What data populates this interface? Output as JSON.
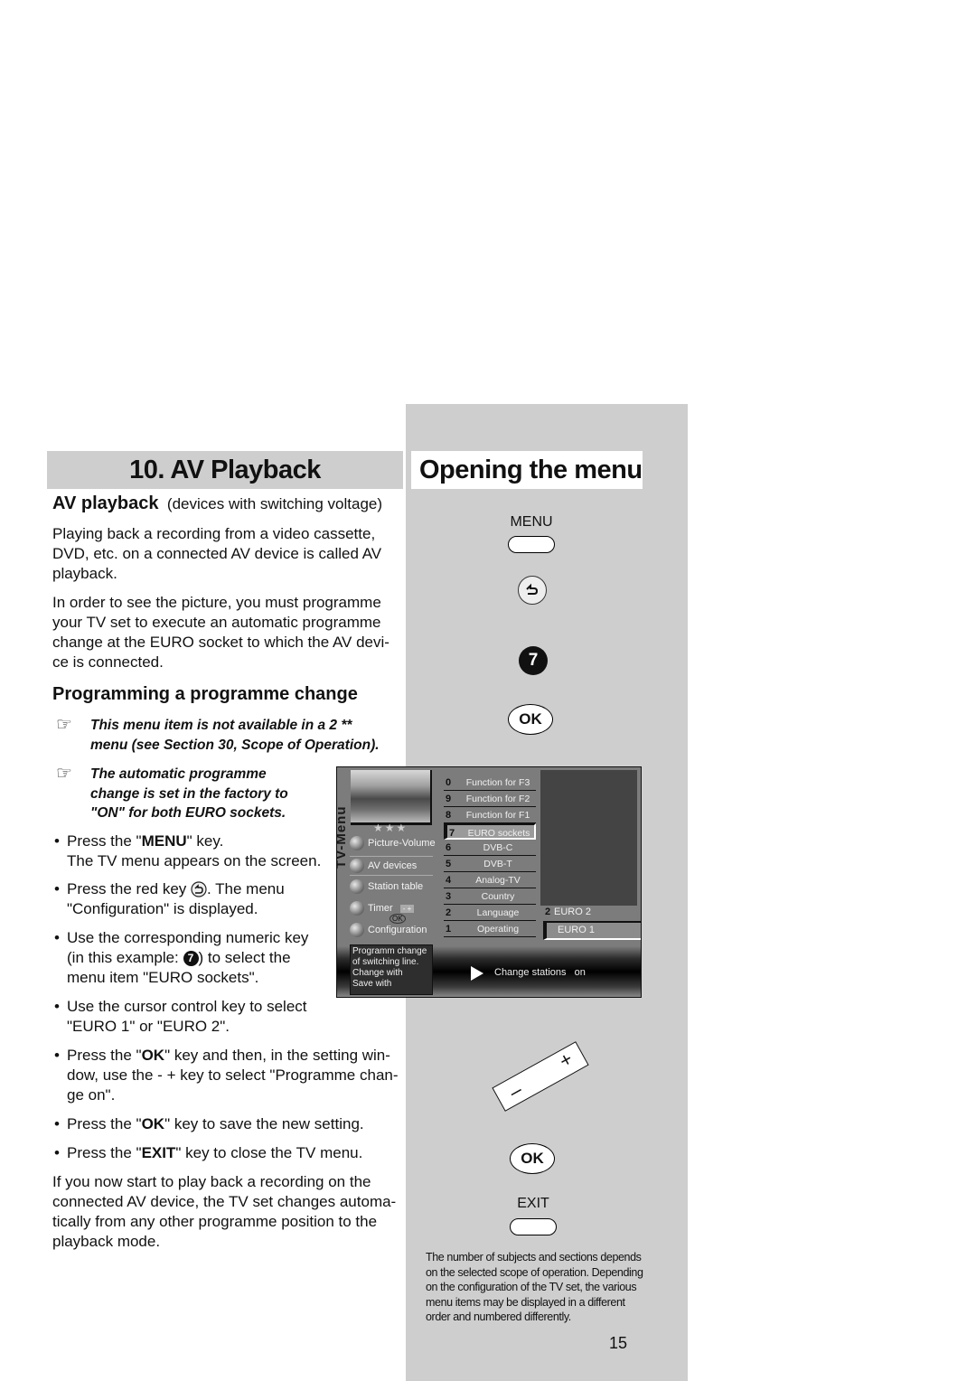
{
  "left": {
    "section_title": "10. AV Playback",
    "subtitle_bold": "AV playback",
    "subtitle_note": "(devices with switching voltage)",
    "intro_p1": [
      "Playing back a recording from a video cassette,",
      "DVD, etc. on a connected AV device is called AV",
      "playback."
    ],
    "intro_p2": [
      "In order to see the picture, you must programme",
      "your TV set to execute an automatic programme",
      "change at the EURO socket to which the AV devi-",
      "ce is connected."
    ],
    "heading": "Programming a programme change",
    "note_icon": "☞",
    "note1": [
      "This menu item is not available in a 2 **",
      "menu (see Section 30, Scope of Operation)."
    ],
    "note2": [
      "The automatic programme",
      "change is set in the factory to",
      "\"ON\" for both EURO sockets."
    ],
    "steps": [
      {
        "pre": "Press the \"",
        "bold": "MENU",
        "post": "\" key.",
        "line2": "The TV menu appears on the screen."
      },
      {
        "pre": "Press the red key ",
        "icon": "red-return-key-icon",
        "post": ". The menu",
        "line2": "\"Configuration\" is displayed."
      },
      {
        "line1": "Use the corresponding numeric key",
        "line2_pre": "(in this example: ",
        "key": "7",
        "line2_post": ") to select the",
        "line3": "menu item \"EURO sockets\"."
      },
      {
        "line1": "Use the cursor control key to select",
        "line2": "\"EURO 1\" or \"EURO 2\"."
      },
      {
        "pre": "Press the \"",
        "bold": "OK",
        "post": "\" key and then, in the setting win-",
        "line2": "dow, use the - + key to select \"Programme chan-",
        "line3": "ge on\"."
      },
      {
        "pre": "Press the \"",
        "bold": "OK",
        "post": "\" key to save the new setting."
      },
      {
        "pre": "Press the \"",
        "bold": "EXIT",
        "post": "\" key to close the TV menu."
      }
    ],
    "closing": [
      "If you now start to play back a recording on the",
      "connected AV device, the TV set changes automa-",
      "tically from any other programme position to the",
      "playback mode."
    ]
  },
  "right": {
    "section_title": "Opening the menu",
    "menu_key_label": "MENU",
    "number_key": "7",
    "ok_label": "OK",
    "exit_key_label": "EXIT",
    "rocker_minus": "–",
    "rocker_plus": "+",
    "footnote": [
      "The number of subjects and sections depends",
      "on the selected scope of operation. Depending",
      "on the configuration of the TV set, the various",
      "menu items may be displayed in a different",
      "order and numbered differently."
    ],
    "page_number": "15"
  },
  "tv": {
    "stars": "★★★",
    "vertical_label": "TV-Menu",
    "menu_items": [
      "Picture-Volume",
      "AV devices",
      "Station table",
      "Timer",
      "Configuration"
    ],
    "timer_hint": "- +",
    "ok_hint": "OK",
    "config_list": [
      {
        "n": "0",
        "label": "Function for F3"
      },
      {
        "n": "9",
        "label": "Function for F2"
      },
      {
        "n": "8",
        "label": "Function for F1"
      },
      {
        "n": "7",
        "label": "EURO sockets",
        "selected": true
      },
      {
        "n": "6",
        "label": "DVB-C"
      },
      {
        "n": "5",
        "label": "DVB-T"
      },
      {
        "n": "4",
        "label": "Analog-TV"
      },
      {
        "n": "3",
        "label": "Country"
      },
      {
        "n": "2",
        "label": "Language"
      },
      {
        "n": "1",
        "label": "Operating"
      }
    ],
    "euro_list": [
      {
        "n": "2",
        "label": "EURO 2"
      },
      {
        "n": "",
        "label": "EURO 1",
        "selected": true
      }
    ],
    "info_lines": [
      "Programm change",
      "of switching line.",
      "Change with",
      "Save with"
    ],
    "status_text": "Change stations   on"
  }
}
